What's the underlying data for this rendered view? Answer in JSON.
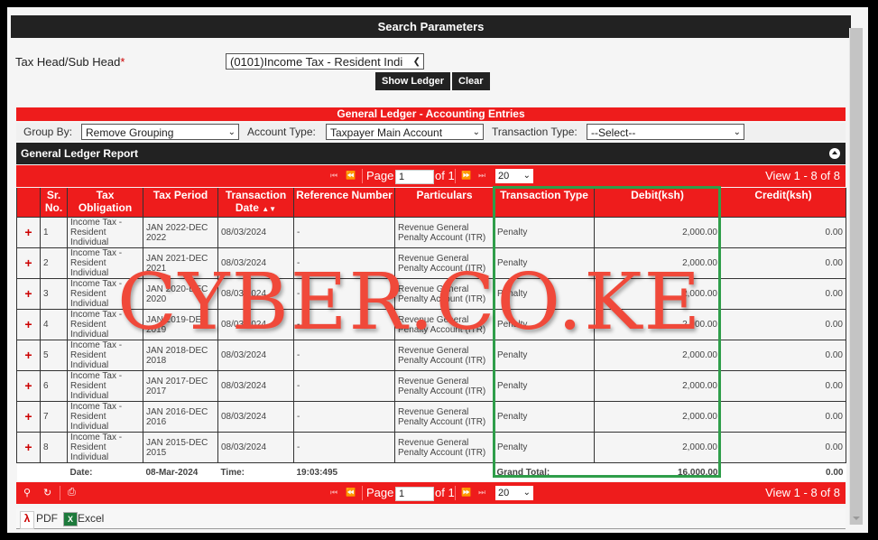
{
  "search": {
    "title": "Search Parameters",
    "tax_head_label": "Tax Head/Sub Head",
    "required_mark": "*",
    "tax_head_value": "(0101)Income Tax - Resident Indi",
    "show_ledger": "Show Ledger",
    "clear": "Clear"
  },
  "ledger": {
    "title": "General Ledger - Accounting Entries",
    "group_by_label": "Group By:",
    "group_by_value": "Remove Grouping",
    "account_type_label": "Account Type:",
    "account_type_value": "Taxpayer Main Account",
    "transaction_type_label": "Transaction Type:",
    "transaction_type_value": "--Select--",
    "report_title": "General Ledger Report"
  },
  "pager": {
    "page_label": "Page",
    "page_value": "1",
    "of_label": "of 1",
    "rows_per_page": "20",
    "view_text": "View 1 - 8 of 8"
  },
  "columns": [
    "Sr. No.",
    "Tax Obligation",
    "Tax Period",
    "Transaction Date",
    "Reference Number",
    "Particulars",
    "Transaction Type",
    "Debit(ksh)",
    "Credit(ksh)"
  ],
  "rows": [
    {
      "sr": "1",
      "obligation": "Income Tax - Resident Individual",
      "period": "JAN 2022-DEC 2022",
      "date": "08/03/2024",
      "ref": "-",
      "particulars": "Revenue General Penalty Account (ITR)",
      "type": "Penalty",
      "debit": "2,000.00",
      "credit": "0.00"
    },
    {
      "sr": "2",
      "obligation": "Income Tax - Resident Individual",
      "period": "JAN 2021-DEC 2021",
      "date": "08/03/2024",
      "ref": "-",
      "particulars": "Revenue General Penalty Account (ITR)",
      "type": "Penalty",
      "debit": "2,000.00",
      "credit": "0.00"
    },
    {
      "sr": "3",
      "obligation": "Income Tax - Resident Individual",
      "period": "JAN 2020-DEC 2020",
      "date": "08/03/2024",
      "ref": "-",
      "particulars": "Revenue General Penalty Account (ITR)",
      "type": "Penalty",
      "debit": "2,000.00",
      "credit": "0.00"
    },
    {
      "sr": "4",
      "obligation": "Income Tax - Resident Individual",
      "period": "JAN 2019-DEC 2019",
      "date": "08/03/2024",
      "ref": "-",
      "particulars": "Revenue General Penalty Account (ITR)",
      "type": "Penalty",
      "debit": "2,000.00",
      "credit": "0.00"
    },
    {
      "sr": "5",
      "obligation": "Income Tax - Resident Individual",
      "period": "JAN 2018-DEC 2018",
      "date": "08/03/2024",
      "ref": "-",
      "particulars": "Revenue General Penalty Account (ITR)",
      "type": "Penalty",
      "debit": "2,000.00",
      "credit": "0.00"
    },
    {
      "sr": "6",
      "obligation": "Income Tax - Resident Individual",
      "period": "JAN 2017-DEC 2017",
      "date": "08/03/2024",
      "ref": "-",
      "particulars": "Revenue General Penalty Account (ITR)",
      "type": "Penalty",
      "debit": "2,000.00",
      "credit": "0.00"
    },
    {
      "sr": "7",
      "obligation": "Income Tax - Resident Individual",
      "period": "JAN 2016-DEC 2016",
      "date": "08/03/2024",
      "ref": "-",
      "particulars": "Revenue General Penalty Account (ITR)",
      "type": "Penalty",
      "debit": "2,000.00",
      "credit": "0.00"
    },
    {
      "sr": "8",
      "obligation": "Income Tax - Resident Individual",
      "period": "JAN 2015-DEC 2015",
      "date": "08/03/2024",
      "ref": "-",
      "particulars": "Revenue General Penalty Account (ITR)",
      "type": "Penalty",
      "debit": "2,000.00",
      "credit": "0.00"
    }
  ],
  "footer": {
    "date_label": "Date:",
    "date_value": "08-Mar-2024",
    "time_label": "Time:",
    "time_value": "19:03:495",
    "grand_total_label": "Grand Total:",
    "grand_total_debit": "16,000.00",
    "grand_total_credit": "0.00"
  },
  "export": {
    "pdf": "PDF",
    "excel": "Excel"
  },
  "watermark": "CYBER.CO.KE",
  "colors": {
    "accent_red": "#ee1c1c",
    "header_dark": "#222222",
    "highlight_green": "#2f9e4a"
  }
}
